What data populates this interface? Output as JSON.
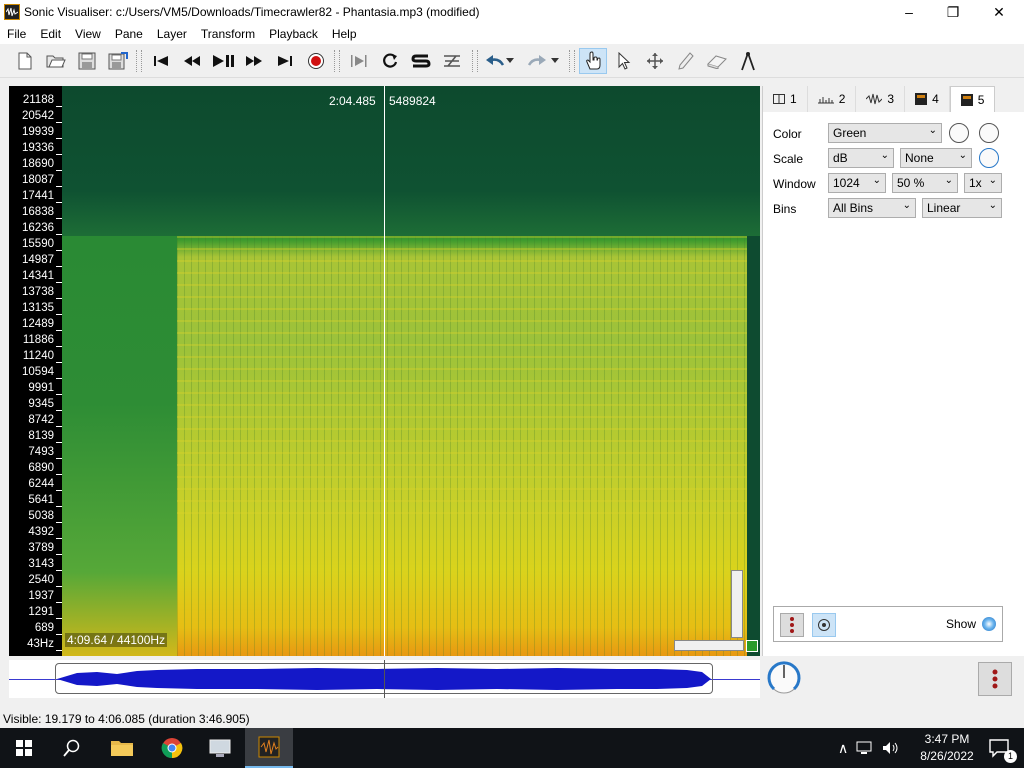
{
  "window": {
    "title": "Sonic Visualiser: c:/Users/VM5/Downloads/Timecrawler82 - Phantasia.mp3 (modified)",
    "minimize": "–",
    "maximize": "❐",
    "close": "✕"
  },
  "menu": [
    "File",
    "Edit",
    "View",
    "Pane",
    "Layer",
    "Transform",
    "Playback",
    "Help"
  ],
  "toolbar": {
    "tools": [
      "new-file",
      "open-file",
      "save-file",
      "save-session",
      "rewind-start",
      "rewind",
      "play-pause",
      "fast-forward",
      "fast-forward-end",
      "record",
      "play-selection",
      "loop",
      "solo",
      "speed",
      "undo",
      "redo",
      "navigate",
      "select",
      "move",
      "draw",
      "erase",
      "measure"
    ],
    "active_tool": "navigate"
  },
  "spectrogram": {
    "frequency_ticks": [
      "21188",
      "20542",
      "19939",
      "19336",
      "18690",
      "18087",
      "17441",
      "16838",
      "16236",
      "15590",
      "14987",
      "14341",
      "13738",
      "13135",
      "12489",
      "11886",
      "11240",
      "10594",
      "9991",
      "9345",
      "8742",
      "8139",
      "7493",
      "6890",
      "6244",
      "5641",
      "5038",
      "4392",
      "3789",
      "3143",
      "2540",
      "1937",
      "1291",
      "689",
      "43Hz"
    ],
    "cursor_time": "2:04.485",
    "cursor_sample": "5489824",
    "duration_rate": "4:09.64 / 44100Hz",
    "colors": {
      "background": "#0d4a2e",
      "low": "#e79812",
      "mid": "#c6cf2a",
      "high": "#3c9a2e"
    }
  },
  "tabs": [
    {
      "label": "1",
      "icon": "pane-icon"
    },
    {
      "label": "2",
      "icon": "ruler-icon"
    },
    {
      "label": "3",
      "icon": "waveform-icon"
    },
    {
      "label": "4",
      "icon": "layer-icon"
    },
    {
      "label": "5",
      "icon": "spectrogram-icon",
      "selected": true
    }
  ],
  "properties": {
    "color_label": "Color",
    "color_value": "Green",
    "scale_label": "Scale",
    "scale_value": "dB",
    "scale_norm": "None",
    "window_label": "Window",
    "window_size": "1024",
    "window_overlap": "50 %",
    "window_oversample": "1x",
    "bins_label": "Bins",
    "bins_value": "All Bins",
    "bins_scale": "Linear",
    "show_label": "Show"
  },
  "status": {
    "visible": "Visible: 19.179 to 4:06.085 (duration 3:46.905)"
  },
  "taskbar": {
    "time": "3:47 PM",
    "date": "8/26/2022",
    "notifications": "1"
  }
}
